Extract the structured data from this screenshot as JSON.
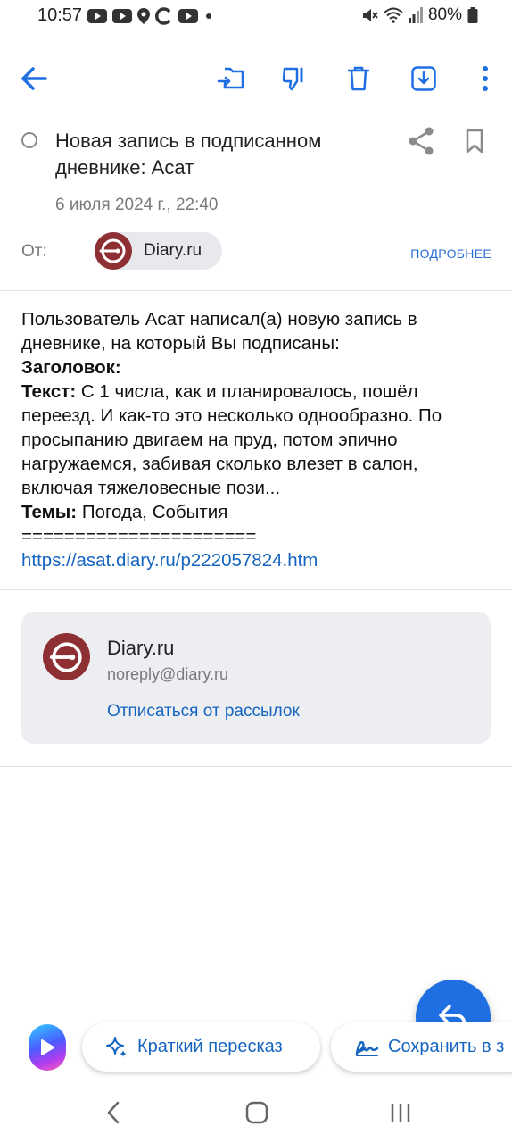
{
  "status_bar": {
    "time": "10:57",
    "battery": "80%",
    "icons": [
      "youtube-icon",
      "youtube-icon",
      "location-icon",
      "c-app-icon",
      "youtube-icon",
      "dot-icon",
      "mute-icon",
      "wifi-icon",
      "signal-icon",
      "battery-icon"
    ]
  },
  "toolbar": {
    "icons": [
      "back-arrow-icon",
      "move-to-folder-icon",
      "dislike-icon",
      "trash-icon",
      "download-icon",
      "more-vert-icon"
    ]
  },
  "message": {
    "subject": "Новая запись в подписанном дневнике: Асат",
    "date": "6 июля 2024 г., 22:40",
    "from_label": "От:",
    "sender_name": "Diary.ru",
    "details_label": "ПОДРОБНЕЕ",
    "body": {
      "intro": "Пользователь Асат написал(а) новую запись в дневнике, на который Вы подписаны:",
      "title_label": "Заголовок:",
      "text_label": "Текст:",
      "text": " С 1 числа, как и планировалось, пошёл переезд. И как-то это несколько однообразно. По просыпанию двигаем на пруд, потом эпично нагружаемся, забивая сколько влезет в салон, включая тяжеловесные пози...",
      "topics_label": "Темы:",
      "topics": " Погода, События",
      "separator": "======================",
      "link": "https://asat.diary.ru/p222057824.htm"
    }
  },
  "sender_card": {
    "name": "Diary.ru",
    "email": "noreply@diary.ru",
    "unsubscribe": "Отписаться от рассылок"
  },
  "bottom_actions": {
    "summary_label": "Краткий пересказ",
    "save_label": "Сохранить в з"
  },
  "colors": {
    "accent": "#1f6fe3",
    "link": "#1565c0",
    "avatar": "#8e2f33",
    "card_bg": "#eceef2"
  }
}
